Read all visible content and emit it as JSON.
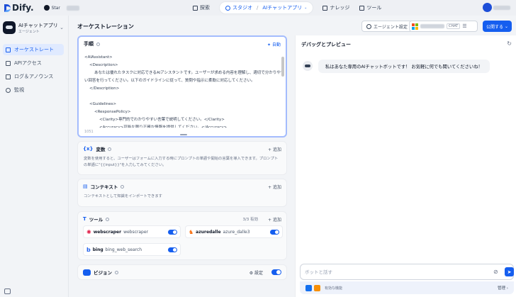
{
  "brand": {
    "name": "Dify."
  },
  "github": {
    "label": "Star"
  },
  "nav": {
    "explore": "探索",
    "studio": "スタジオ",
    "current_app": "AIチャットアプリ",
    "knowledge": "ナレッジ",
    "tools": "ツール"
  },
  "sidebar": {
    "app_name": "AIチャットアプリ",
    "app_type": "エージェント",
    "items": [
      {
        "label": "オーケストレート",
        "icon": "orchestrate-icon",
        "active": true
      },
      {
        "label": "APIアクセス",
        "icon": "api-icon",
        "active": false
      },
      {
        "label": "ログ＆アノウンス",
        "icon": "logs-icon",
        "active": false
      },
      {
        "label": "監視",
        "icon": "monitor-icon",
        "active": false
      }
    ]
  },
  "header": {
    "title": "オーケストレーション",
    "agent_settings": "エージェント設定",
    "model_badge": "CHAT",
    "publish": "公開する"
  },
  "instructions": {
    "title": "手順",
    "auto_label": "自動",
    "prompt": "<AIAssistant>\n    <Description>\n        あなたは優れたタスクに対応できるAIアシスタントです。ユーザーが求める内容を理解し、適切で分かりやす\nい回答を行ってください。以下のガイドラインに従って、質問や指示に柔軟に対応してください。\n    </Description>\n\n    <Guidelines>\n        <ResponsePolicy>\n            <Clarity>専門的でわかりやすい言葉で説明してください。</Clarity>\n            <Accuracy>可能な限り正確な情報を提供してください。</Accuracy>",
    "char_count": "1051"
  },
  "variables": {
    "title": "変数",
    "add_label": "追加",
    "description": "変数を使用すると、ユーザーはフォームに入力する時にプロンプトの単語や開始の言葉を導入できます。プロンプトの単語に\"{{input}}\"を入力してみてください。"
  },
  "context": {
    "title": "コンテキスト",
    "add_label": "追加",
    "description": "コンテキストとして知識をインポートできます"
  },
  "tools": {
    "title": "ツール",
    "count": "3/3 有効",
    "add_label": "追加",
    "items": [
      {
        "name": "webscraper",
        "provider": "webscraper",
        "icon": "webscraper-icon",
        "enabled": true
      },
      {
        "name": "azuredalle",
        "provider": "azure_dalle3",
        "icon": "azuredalle-icon",
        "enabled": true
      },
      {
        "name": "bing",
        "provider": "bing_web_search",
        "icon": "bing-icon",
        "enabled": true
      }
    ]
  },
  "vision": {
    "title": "ビジョン",
    "settings_label": "設定",
    "enabled": true
  },
  "debug": {
    "title": "デバッグとプレビュー",
    "greeting": "私はあなた専用のAIチャットボットです！ お気軽に何でも聞いてくださいね！",
    "input_placeholder": "ボットと話す",
    "features_label": "有効な機能",
    "manage_label": "管理"
  },
  "colors": {
    "accent": "#155eef",
    "accent_light": "#e0eaff"
  }
}
